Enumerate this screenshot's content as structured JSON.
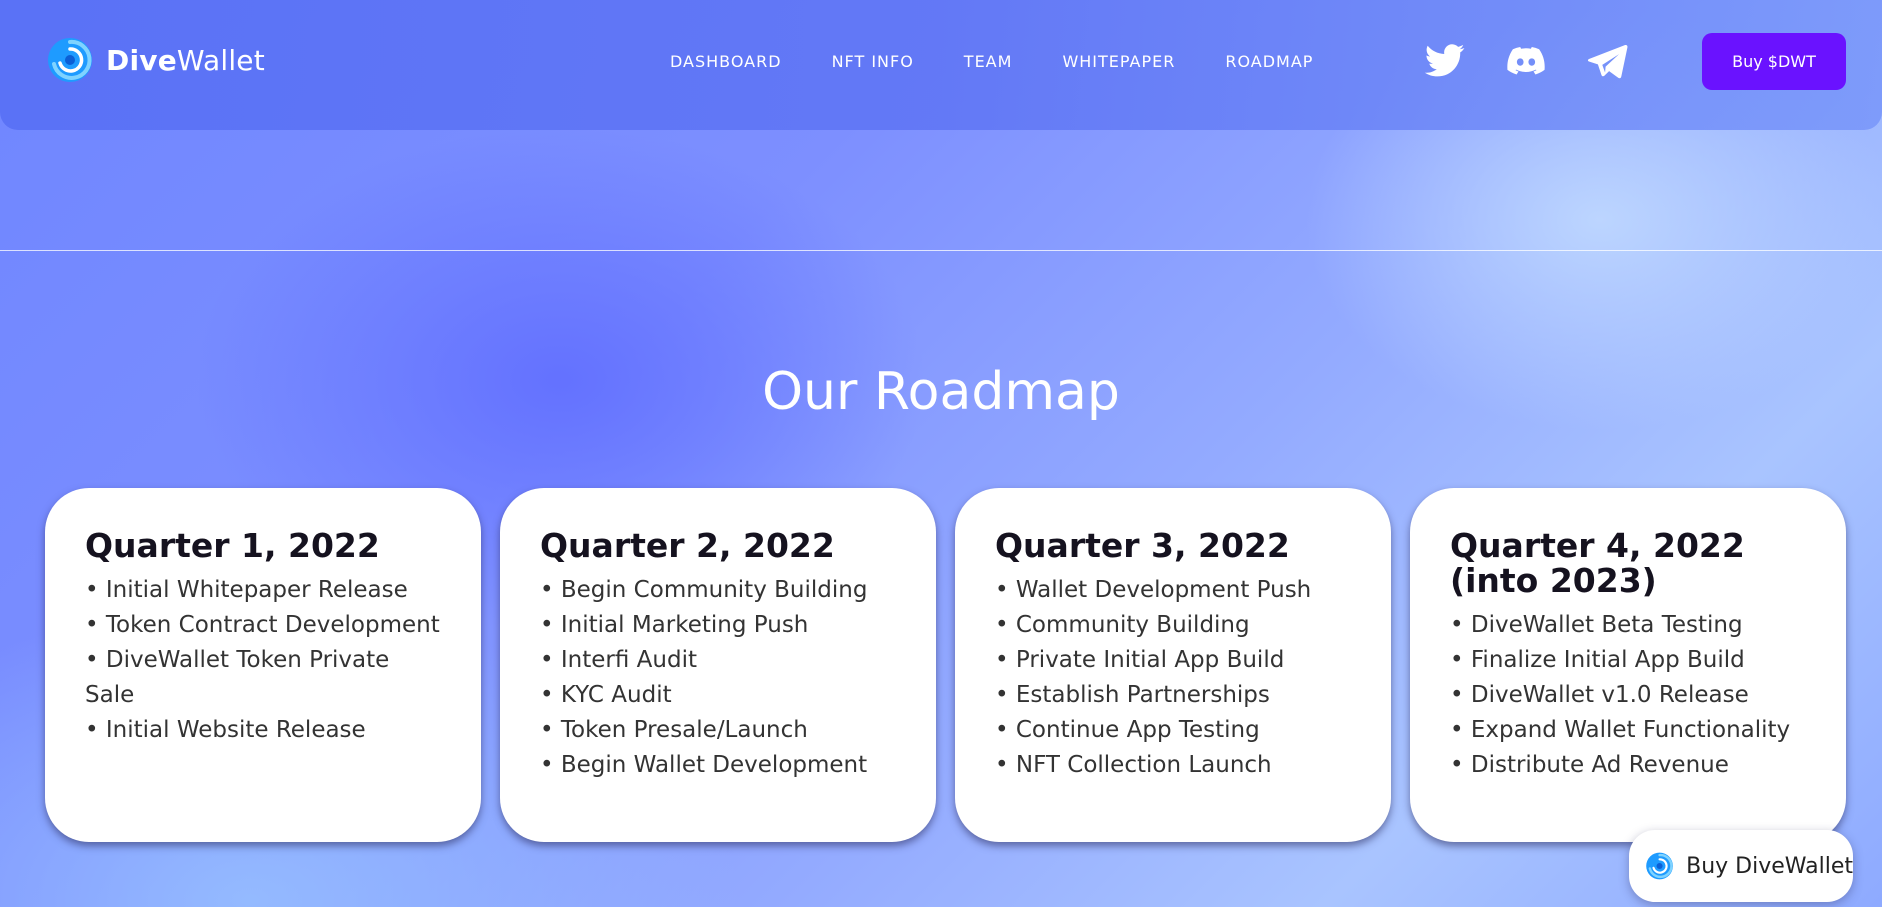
{
  "brand": {
    "name_bold": "Dive",
    "name_rest": "Wallet",
    "logo_icon": "swirl-logo-icon"
  },
  "nav": {
    "items": [
      {
        "label": "DASHBOARD"
      },
      {
        "label": "NFT INFO"
      },
      {
        "label": "TEAM"
      },
      {
        "label": "WHITEPAPER"
      },
      {
        "label": "ROADMAP"
      }
    ]
  },
  "socials": [
    {
      "icon": "twitter-icon"
    },
    {
      "icon": "discord-icon"
    },
    {
      "icon": "telegram-icon"
    }
  ],
  "header": {
    "buy_label": "Buy $DWT"
  },
  "roadmap": {
    "title": "Our Roadmap",
    "quarters": [
      {
        "title": "Quarter 1, 2022",
        "items": [
          "• Initial Whitepaper Release",
          "• Token Contract Development",
          "• DiveWallet Token Private Sale",
          "• Initial Website Release"
        ]
      },
      {
        "title": "Quarter 2, 2022",
        "items": [
          "• Begin Community Building",
          "• Initial Marketing Push",
          "• Interfi Audit",
          "• KYC Audit",
          "• Token Presale/Launch",
          "• Begin Wallet Development"
        ]
      },
      {
        "title": "Quarter 3, 2022",
        "items": [
          "• Wallet Development Push",
          "• Community Building",
          "• Private Initial App Build",
          "• Establish Partnerships",
          "• Continue App Testing",
          "• NFT Collection Launch"
        ]
      },
      {
        "title": "Quarter 4, 2022 (into 2023)",
        "items": [
          "• DiveWallet Beta Testing",
          "• Finalize Initial App Build",
          "• DiveWallet v1.0 Release",
          "• Expand Wallet Functionality",
          "• Distribute Ad Revenue"
        ]
      }
    ]
  },
  "floating": {
    "label": "Buy DiveWallet"
  },
  "colors": {
    "accent": "#6a12ff",
    "logo_blue": "#1e9bff"
  }
}
